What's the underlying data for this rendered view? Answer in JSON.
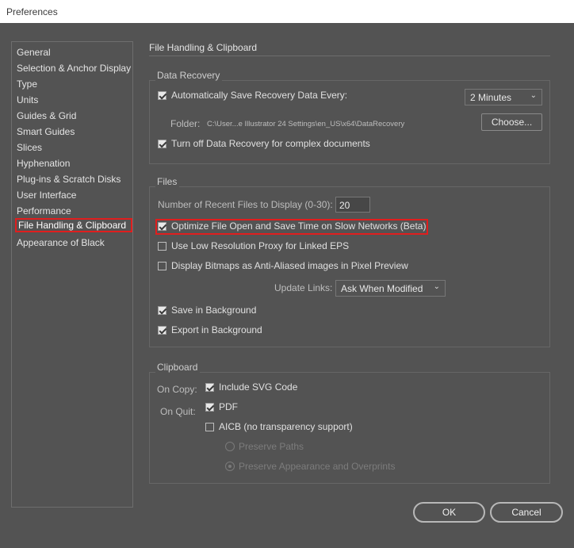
{
  "window": {
    "title": "Preferences"
  },
  "sidebar": {
    "items": [
      {
        "label": "General"
      },
      {
        "label": "Selection & Anchor Display"
      },
      {
        "label": "Type"
      },
      {
        "label": "Units"
      },
      {
        "label": "Guides & Grid"
      },
      {
        "label": "Smart Guides"
      },
      {
        "label": "Slices"
      },
      {
        "label": "Hyphenation"
      },
      {
        "label": "Plug-ins & Scratch Disks"
      },
      {
        "label": "User Interface"
      },
      {
        "label": "Performance"
      },
      {
        "label": "File Handling & Clipboard",
        "selected": true
      },
      {
        "label": "Appearance of Black"
      }
    ]
  },
  "main": {
    "title": "File Handling & Clipboard",
    "data_recovery": {
      "label": "Data Recovery",
      "auto_save": {
        "label": "Automatically Save Recovery Data Every:",
        "checked": true
      },
      "interval_select": {
        "value": "2 Minutes"
      },
      "folder_label": "Folder:",
      "folder_path": "C:\\User...e Illustrator 24 Settings\\en_US\\x64\\DataRecovery",
      "choose_button": "Choose...",
      "turn_off": {
        "label": "Turn off Data Recovery for complex documents",
        "checked": true
      }
    },
    "files": {
      "label": "Files",
      "recent_files_label": "Number of Recent Files to Display (0-30):",
      "recent_files_value": "20",
      "optimize": {
        "label": "Optimize File Open and Save Time on Slow Networks (Beta)",
        "checked": true
      },
      "low_res_proxy": {
        "label": "Use Low Resolution Proxy for Linked EPS",
        "checked": false
      },
      "display_bitmaps": {
        "label": "Display Bitmaps as Anti-Aliased images in Pixel Preview",
        "checked": false
      },
      "update_links_label": "Update Links:",
      "update_links_value": "Ask When Modified",
      "save_bg": {
        "label": "Save in Background",
        "checked": true
      },
      "export_bg": {
        "label": "Export in Background",
        "checked": true
      }
    },
    "clipboard": {
      "label": "Clipboard",
      "on_copy_label": "On Copy:",
      "include_svg": {
        "label": "Include SVG Code",
        "checked": true
      },
      "on_quit_label": "On Quit:",
      "pdf": {
        "label": "PDF",
        "checked": true
      },
      "aicb": {
        "label": "AICB (no transparency support)",
        "checked": false
      },
      "preserve_paths": {
        "label": "Preserve Paths",
        "selected": false
      },
      "preserve_appearance": {
        "label": "Preserve Appearance and Overprints",
        "selected": true
      }
    }
  },
  "footer": {
    "ok": "OK",
    "cancel": "Cancel"
  },
  "colors": {
    "background": "#535353",
    "highlight": "#e01e1e",
    "titlebar": "#ffffff"
  }
}
